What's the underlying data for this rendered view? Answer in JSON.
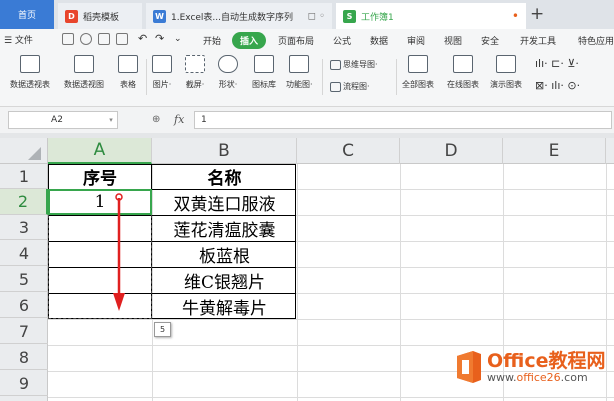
{
  "tabs": {
    "home": "首页",
    "tab1": {
      "label": "稻壳模板",
      "icon_color": "#e8452c",
      "icon": "D"
    },
    "tab2": {
      "label": "1.Excel表...自动生成数字序列",
      "icon_color": "#3a7bd5",
      "icon": "W"
    },
    "tab3": {
      "label": "工作簿1",
      "icon_color": "#37a64d",
      "icon": "S"
    },
    "plus": "+"
  },
  "menu": {
    "file": "☰ 文件",
    "items": [
      "开始",
      "插入",
      "页面布局",
      "公式",
      "数据",
      "审阅",
      "视图",
      "安全",
      "开发工具",
      "特色应用"
    ],
    "active": "插入"
  },
  "ribbon": {
    "buttons": [
      "数据透视表",
      "数据透视图",
      "表格",
      "图片·",
      "截屏·",
      "形状·",
      "图标库",
      "功能图·",
      "全部图表",
      "在线图表",
      "演示图表"
    ],
    "side": [
      "思维导图·",
      "流程图·"
    ]
  },
  "formula_bar": {
    "name_box": "A2",
    "fx": "fx",
    "value": "1"
  },
  "columns": [
    "A",
    "B",
    "C",
    "D",
    "E"
  ],
  "rows": [
    "1",
    "2",
    "3",
    "4",
    "5",
    "6",
    "7",
    "8",
    "9"
  ],
  "cells": {
    "A1": "序号",
    "B1": "名称",
    "A2": "1",
    "B2": "双黄连口服液",
    "B3": "莲花清瘟胶囊",
    "B4": "板蓝根",
    "B5": "维C银翘片",
    "B6": "牛黄解毒片"
  },
  "fill_badge": "5",
  "accent_color": "#37a64d",
  "watermark": {
    "title": "Office教程网",
    "url_prefix": "www.",
    "url_brand": "office26",
    "url_suffix": ".com"
  }
}
